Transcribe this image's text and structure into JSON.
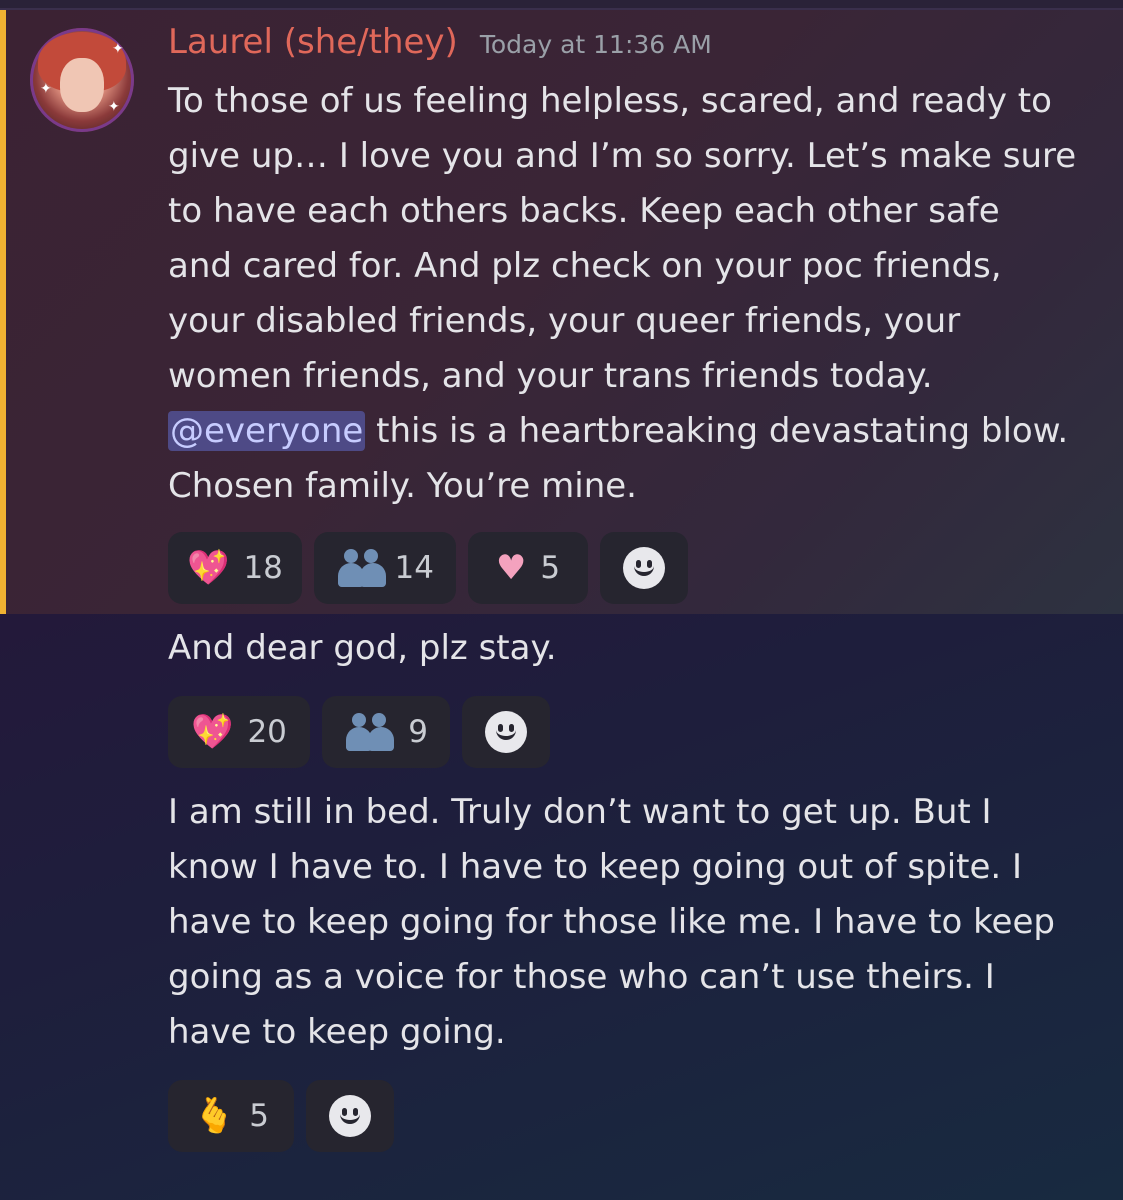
{
  "message": {
    "author": "Laurel (she/they)",
    "timestamp": "Today at 11:36 AM",
    "lines_before_mention": [
      "To those of us feeling helpless, scared, and ready to",
      "give up… I love you and I’m so sorry. Let’s make sure",
      "to have each others backs. Keep each other safe",
      "and cared for. And plz check on your poc friends,",
      "your disabled friends, your queer friends, your",
      "women friends, and your trans friends today."
    ],
    "mention": "@everyone",
    "after_mention": " this is a heartbreaking devastating blow.",
    "last_line": "Chosen family. You’re mine.",
    "reactions": [
      {
        "emoji": "sparkling-heart-icon",
        "glyph": "💖",
        "count": "18"
      },
      {
        "emoji": "people-hugging-icon",
        "glyph": "🫂",
        "count": "14"
      },
      {
        "emoji": "heart-icon",
        "glyph": "🩷",
        "count": "5"
      }
    ]
  },
  "message2": {
    "text": "And dear god, plz stay.",
    "reactions": [
      {
        "emoji": "sparkling-heart-icon",
        "glyph": "💖",
        "count": "20"
      },
      {
        "emoji": "people-hugging-icon",
        "glyph": "🫂",
        "count": "9"
      }
    ]
  },
  "message3": {
    "lines": [
      "I am still in bed. Truly don’t want to get up. But I",
      "know I have to. I have to keep going out of spite. I",
      "have to keep going for those like me. I have to keep",
      "going as a voice for those who can’t use theirs. I",
      "have to keep going."
    ],
    "reactions": [
      {
        "emoji": "hand-with-index-finger-and-thumb-crossed-icon",
        "glyph": "🫰",
        "count": "5"
      }
    ]
  },
  "colors": {
    "username": "#e0685a",
    "mention_bar": "#f0b232",
    "mention_bg": "#4e4a86",
    "reaction_bg": "#26252f"
  }
}
